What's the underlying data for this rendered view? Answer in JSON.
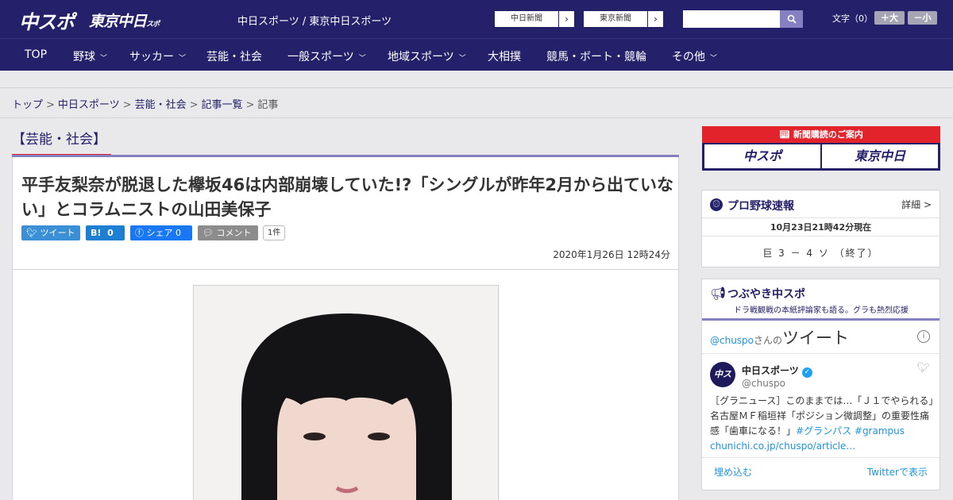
{
  "header": {
    "logo_chuspo": "中スポ",
    "logo_tokyo": "東京中日",
    "logo_tokyo_small": "スポ",
    "site_link": "中日スポーツ / 東京中日スポーツ",
    "paper_buttons": [
      "中日新聞",
      "東京新聞"
    ],
    "fontsize_label": "文字（0）",
    "fontsize_plus": "＋大",
    "fontsize_minus": "－小"
  },
  "nav": {
    "items": [
      {
        "label": "TOP",
        "has_dropdown": false
      },
      {
        "label": "野球",
        "has_dropdown": true
      },
      {
        "label": "サッカー",
        "has_dropdown": true
      },
      {
        "label": "芸能・社会",
        "has_dropdown": false
      },
      {
        "label": "一般スポーツ",
        "has_dropdown": true
      },
      {
        "label": "地域スポーツ",
        "has_dropdown": true
      },
      {
        "label": "大相撲",
        "has_dropdown": false
      },
      {
        "label": "競馬・ボート・競輪",
        "has_dropdown": false
      },
      {
        "label": "その他",
        "has_dropdown": true
      }
    ]
  },
  "breadcrumb": {
    "items": [
      "トップ",
      "中日スポーツ",
      "芸能・社会",
      "記事一覧",
      "記事"
    ],
    "separator": ">"
  },
  "article": {
    "category": "【芸能・社会】",
    "title": "平手友梨奈が脱退した欅坂46は内部崩壊していた!?「シングルが昨年2月から出ていない」とコラムニストの山田美保子",
    "share": {
      "tweet": "ツイート",
      "hatena_label": "B!",
      "hatena_count": "0",
      "facebook": "シェア",
      "facebook_count": "0",
      "comment": "コメント",
      "comment_count": "1件"
    },
    "date": "2020年1月26日 12時24分"
  },
  "sidebar": {
    "newspaper_heading": "新聞購読のご案内",
    "newspaper_buttons": [
      "中スポ",
      "東京中日"
    ],
    "baseball": {
      "title": "プロ野球速報",
      "detail": "詳細 >",
      "time": "10月23日21時42分現在",
      "score": "巨 3 － 4 ソ （終了）"
    },
    "tsubuyaki": {
      "title": "つぶやき中スポ",
      "subtitle": "ドラ戦観戦の本紙評論家も語る。グラも熱烈応援",
      "tw_handle_prefix": "@chuspo",
      "tw_handle_suffix": "さんの",
      "tw_header_big": "ツイート",
      "account_name": "中日スポーツ",
      "account_handle": "@chuspo",
      "avatar_text": "中スポ",
      "tweet_text": "［グラニュース］このままでは…「Ｊ１でやられる」名古屋ＭＦ稲垣祥「ポジション微調整」の重要性痛感「歯車になる！」",
      "tweet_tags": "#グランパス #grampus",
      "tweet_link": "chunichi.co.jp/chuspo/article…",
      "embed": "埋め込む",
      "view_on_twitter": "Twitterで表示"
    }
  },
  "colors": {
    "navy": "#24206a",
    "red": "#e2232c",
    "lavender": "#8580c2"
  }
}
